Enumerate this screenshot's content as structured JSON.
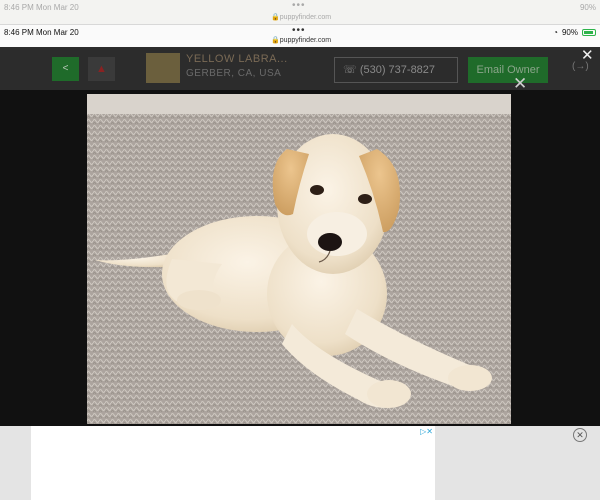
{
  "ghost_status": {
    "time": "8:46 PM",
    "date": "Mon Mar 20",
    "url": "puppyfinder.com",
    "battery": "90%"
  },
  "status_bar": {
    "time": "8:46 PM",
    "date": "Mon Mar 20",
    "url": "puppyfinder.com",
    "battery": "90%"
  },
  "listing": {
    "title": "YELLOW LABRA...",
    "location": "GERBER, CA, USA",
    "phone": "(530) 737-8827",
    "email_label": "Email Owner"
  },
  "icons": {
    "share": "share-icon",
    "warning": "warning-icon",
    "close": "close-icon",
    "ad_choices": "ad-choices-icon"
  },
  "colors": {
    "brand_green": "#1f6b2a",
    "overlay": "#111111",
    "battery_green": "#2db34a"
  }
}
